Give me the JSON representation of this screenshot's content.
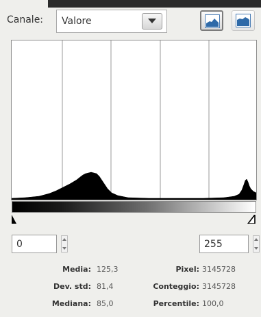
{
  "channel": {
    "label": "Canale:",
    "value": "Valore"
  },
  "scale_buttons": [
    {
      "name": "linear-scale-button",
      "icon": "linear-histogram-icon",
      "active": true
    },
    {
      "name": "log-scale-button",
      "icon": "log-histogram-icon",
      "active": false
    }
  ],
  "histogram": {
    "range_min": "0",
    "range_max": "255",
    "colors": {
      "border": "#8f8f8f",
      "grid": "#9a9a9a",
      "fill": "#000000",
      "accent": "#4a7db5"
    }
  },
  "stats": {
    "media": {
      "label": "Media:",
      "value": "125,3"
    },
    "dev_std": {
      "label": "Dev. std:",
      "value": "81,4"
    },
    "mediana": {
      "label": "Mediana:",
      "value": "85,0"
    },
    "pixel": {
      "label": "Pixel:",
      "value": "3145728"
    },
    "conteggio": {
      "label": "Conteggio:",
      "value": "3145728"
    },
    "percentile": {
      "label": "Percentile:",
      "value": "100,0"
    }
  }
}
